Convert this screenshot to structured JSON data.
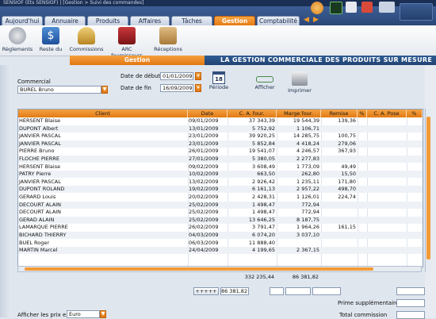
{
  "window": {
    "title": "SENSIOF (Ets SENSIOF) | [Gestion > Suivi des commandes]"
  },
  "tabs": [
    {
      "label": "Aujourd'hui",
      "active": false
    },
    {
      "label": "Annuaire",
      "active": false
    },
    {
      "label": "Produits",
      "active": false
    },
    {
      "label": "Affaires",
      "active": false
    },
    {
      "label": "Tâches",
      "active": false
    },
    {
      "label": "Gestion",
      "active": true
    },
    {
      "label": "Comptabilité",
      "active": false
    }
  ],
  "toolbar": [
    {
      "label": "Règlements",
      "icon": "coins-icon"
    },
    {
      "label": "Reste du",
      "icon": "dollar-icon"
    },
    {
      "label": "Commissions",
      "icon": "trophy-icon"
    },
    {
      "label": "ARC fournisseurs",
      "icon": "truck-icon"
    },
    {
      "label": "Réceptions",
      "icon": "box-icon"
    }
  ],
  "banner": {
    "section": "Gestion",
    "title": "LA GESTION COMMERCIALE DES PRODUITS SUR MESURE"
  },
  "filters": {
    "commercial_label": "Commercial",
    "commercial_value": "BUREL Bruno",
    "start_label": "Date de début",
    "start_value": "01/01/2009",
    "end_label": "Date de fin",
    "end_value": "16/09/2009",
    "period_label": "Période",
    "period_day": "18",
    "show_label": "Afficher",
    "print_label": "Imprimer"
  },
  "grid": {
    "columns": [
      "Client",
      "Date",
      "C. A. four.",
      "Marge four.",
      "Remise",
      "%",
      "C. A. Pose",
      "%"
    ],
    "rows": [
      [
        "HERSENT Blaise",
        "09/01/2009",
        "37 343,39",
        "19 544,39",
        "139,36"
      ],
      [
        "DUPONT Albert",
        "13/01/2009",
        "5 752,92",
        "1 106,71",
        ""
      ],
      [
        "JANVIER PASCAL",
        "23/01/2009",
        "39 920,25",
        "14 285,75",
        "100,75"
      ],
      [
        "JANVIER PASCAL",
        "23/01/2009",
        "5 852,84",
        "4 418,24",
        "279,06"
      ],
      [
        "PIERRE Bruno",
        "26/01/2009",
        "19 541,07",
        "4 246,57",
        "367,93"
      ],
      [
        "FLOCHE PIERRE",
        "27/01/2009",
        "5 380,05",
        "2 277,83",
        ""
      ],
      [
        "HERSENT Blaise",
        "09/02/2009",
        "3 608,49",
        "1 773,09",
        "49,49"
      ],
      [
        "PATRY Pierre",
        "10/02/2009",
        "663,50",
        "262,80",
        "15,50"
      ],
      [
        "JANVIER PASCAL",
        "13/02/2009",
        "2 926,42",
        "1 235,11",
        "171,80"
      ],
      [
        "DUPONT ROLAND",
        "19/02/2009",
        "6 161,13",
        "2 957,22",
        "498,70"
      ],
      [
        "GERARD Louis",
        "20/02/2009",
        "2 428,31",
        "1 126,01",
        "224,74"
      ],
      [
        "DECOURT ALAIN",
        "25/02/2009",
        "1 498,47",
        "772,94",
        ""
      ],
      [
        "DECOURT ALAIN",
        "25/02/2009",
        "1 498,47",
        "772,94",
        ""
      ],
      [
        "GERAD ALAIN",
        "25/02/2009",
        "13 646,25",
        "8 187,75",
        ""
      ],
      [
        "LAMARQUE PIERRE",
        "26/02/2009",
        "3 791,47",
        "1 964,26",
        "161,15"
      ],
      [
        "BICHARD THIERRY",
        "04/03/2009",
        "6 074,20",
        "3 037,10",
        ""
      ],
      [
        "BUEL Roger",
        "06/03/2009",
        "11 888,40",
        "",
        ""
      ],
      [
        "MARTIN Marcel",
        "24/04/2009",
        "4 199,65",
        "2 367,15",
        ""
      ]
    ],
    "total_ca": "332 235,44",
    "total_marge": "86 381,82"
  },
  "footer": {
    "plus_button": "+++++",
    "plus_value": "86 381,82",
    "prime_label": "Prime supplémentaire",
    "total_commission_label": "Total commission",
    "show_prices_label": "Afficher les prix en",
    "show_prices_value": "Euro"
  }
}
